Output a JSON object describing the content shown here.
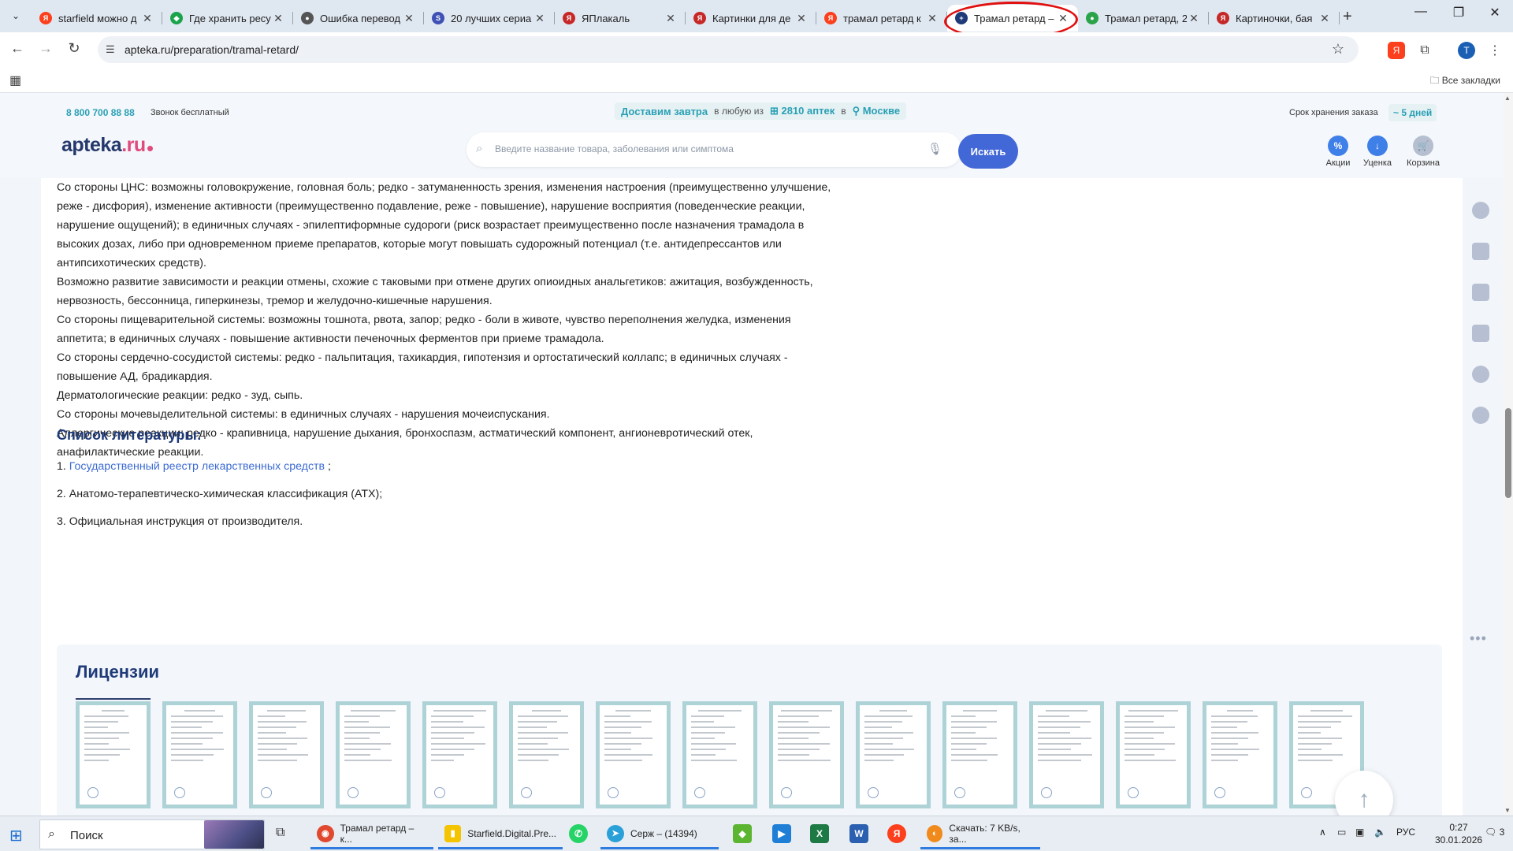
{
  "browser": {
    "tabs": [
      {
        "title": "starfield можно д",
        "icon_color": "#fc3f1d",
        "icon": "Я"
      },
      {
        "title": "Где хранить ресу",
        "icon_color": "#1aa34a",
        "icon": "◆"
      },
      {
        "title": "Ошибка перевод",
        "icon_color": "#555555",
        "icon": "●"
      },
      {
        "title": "20 лучших сериа",
        "icon_color": "#3f51b5",
        "icon": "S"
      },
      {
        "title": "ЯПлакаль",
        "icon_color": "#c62828",
        "icon": "Я"
      },
      {
        "title": "Картинки для де",
        "icon_color": "#c62828",
        "icon": "Я"
      },
      {
        "title": "трамал ретард к",
        "icon_color": "#fc3f1d",
        "icon": "Я"
      },
      {
        "title": "Трамал ретард –",
        "icon_color": "#1e3a78",
        "icon": "+",
        "active": true
      },
      {
        "title": "Трамал ретард, 2",
        "icon_color": "#2aa34a",
        "icon": "●"
      },
      {
        "title": "Картиночки, бая",
        "icon_color": "#c62828",
        "icon": "Я"
      }
    ],
    "new_tab": "+",
    "url": "apteka.ru/preparation/tramal-retard/",
    "all_bookmarks": "Все закладки",
    "profile_initial": "T"
  },
  "site": {
    "phone": "8 800 700 88 88",
    "free_call": "Звонок бесплатный",
    "delivery_label": "Доставим завтра",
    "delivery_any": "в любую из",
    "pharmacies": "2810 аптек",
    "delivery_in": "в",
    "city": "Москве",
    "storage_label": "Срок хранения заказа",
    "storage_days": "~ 5 дней",
    "logo_main": "apteka",
    "logo_ru": ".ru",
    "search_placeholder": "Введите название товара, заболевания или симптома",
    "search_button": "Искать",
    "header_icons": [
      {
        "label": "Акции",
        "color": "#3f7fe8"
      },
      {
        "label": "Уценка",
        "color": "#3f7fe8"
      },
      {
        "label": "Корзина",
        "color": "#b5bfd0"
      }
    ]
  },
  "article": {
    "paragraphs": [
      "Со стороны ЦНС: возможны головокружение, головная боль; редко - затуманенность зрения, изменения настроения (преимущественно улучшение, реже - дисфория), изменение активности (преимущественно подавление, реже - повышение), нарушение восприятия (поведенческие реакции, нарушение ощущений); в единичных случаях - эпилептиформные судороги (риск возрастает преимущественно после назначения трамадола в высоких дозах, либо при одновременном приеме препаратов, которые могут повышать судорожный потенциал (т.е. антидепрессантов или антипсихотических средств).",
      "Возможно развитие зависимости и реакции отмены, схожие с таковыми при отмене других опиоидных анальгетиков: ажитация, возбужденность, нервозность, бессонница, гиперкинезы, тремор и желудочно-кишечные нарушения.",
      "Со стороны пищеварительной системы: возможны тошнота, рвота, запор; редко - боли в животе, чувство переполнения желудка, изменения аппетита; в единичных случаях - повышение активности печеночных ферментов при приеме трамадола.",
      "Со стороны сердечно-сосудистой системы: редко - пальпитация, тахикардия, гипотензия и ортостатический коллапс; в единичных случаях - повышение АД, брадикардия.",
      "Дерматологические реакции: редко - зуд, сыпь.",
      "Со стороны мочевыделительной системы: в единичных случаях - нарушения мочеиспускания.",
      "Аллергические реакции: редко - крапивница, нарушение дыхания, бронхоспазм, астматический компонент, ангионевротический отек, анафилактические реакции."
    ]
  },
  "literature": {
    "title": "Список литературы:",
    "item1_num": "1.",
    "item1_link": "Государственный реестр лекарственных средств",
    "item1_tail": ";",
    "item2": "2. Анатомо-терапевтическо-химическая классификация (АТХ);",
    "item3": "3. Официальная инструкция от производителя."
  },
  "licenses": {
    "title": "Лицензии",
    "count": 15
  },
  "taskbar": {
    "search": "Поиск",
    "apps": [
      {
        "label": "Трамал ретард – к...",
        "color": "#e0492f",
        "icon": "◉",
        "open": true
      },
      {
        "label": "Starfield.Digital.Pre...",
        "color": "#f5c400",
        "icon": "▮",
        "open": true
      },
      {
        "label": "Серж – (14394)",
        "color": "#2aa0d8",
        "icon": "➤",
        "open": true
      },
      {
        "label": "Скачать: 7 KB/s, за...",
        "color": "#f08a1c",
        "icon": "◐",
        "open": true
      }
    ],
    "lang": "РУС",
    "time": "0:27",
    "date": "30.01.2026",
    "notifications": "3"
  }
}
